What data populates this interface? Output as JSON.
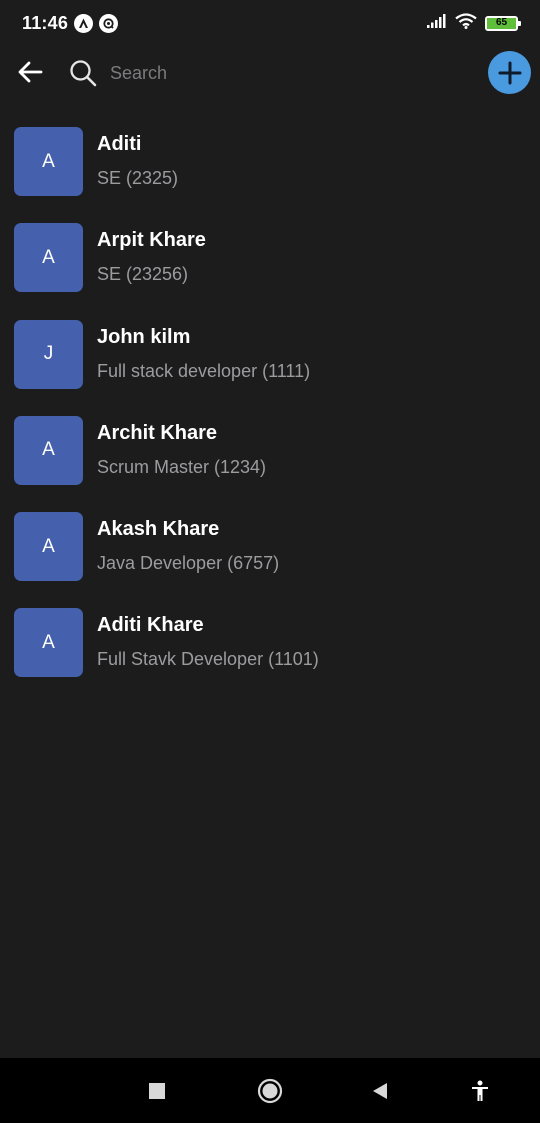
{
  "status_bar": {
    "time": "11:46",
    "battery_level": "65",
    "battery_color": "#5fbf3a"
  },
  "toolbar": {
    "back_icon": "arrow-left-icon",
    "search_icon": "search-icon",
    "search_placeholder": "Search",
    "search_value": "",
    "add_icon": "plus-icon",
    "accent_color": "#4a9ae0"
  },
  "employees": [
    {
      "initial": "A",
      "name": "Aditi",
      "role": "SE (2325)"
    },
    {
      "initial": "A",
      "name": "Arpit Khare",
      "role": "SE (23256)"
    },
    {
      "initial": "J",
      "name": "John kilm",
      "role": "Full stack developer (1111)"
    },
    {
      "initial": "A",
      "name": "Archit Khare",
      "role": "Scrum Master (1234)"
    },
    {
      "initial": "A",
      "name": "Akash Khare",
      "role": "Java Developer (6757)"
    },
    {
      "initial": "A",
      "name": "Aditi Khare",
      "role": "Full Stavk Developer (1101)"
    }
  ],
  "avatar_color": "#4561ad",
  "nav_bar": {
    "buttons": [
      "recents-square-icon",
      "home-circle-icon",
      "back-triangle-icon",
      "accessibility-icon"
    ]
  }
}
